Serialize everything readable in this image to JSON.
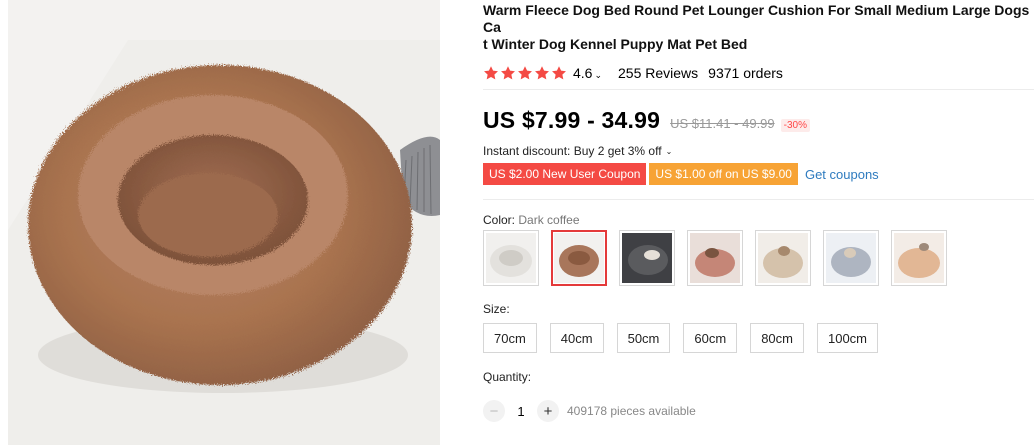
{
  "product": {
    "title": "Warm Fleece Dog Bed Round Pet Lounger Cushion For Small Medium Large Dogs Ca\nt Winter Dog Kennel Puppy Mat Pet Bed",
    "image_alt": "Round fluffy dark coffee pet bed"
  },
  "rating": {
    "value": "4.6",
    "stars": 5,
    "star_color": "#f44a44",
    "reviews": "255 Reviews",
    "orders": "9371 orders"
  },
  "pricing": {
    "price": "US $7.99 - 34.99",
    "original_price": "US $11.41 - 49.99",
    "discount": "-30%",
    "instant_discount": "Instant discount: Buy 2 get 3% off"
  },
  "coupons": {
    "new_user": "US $2.00 New User Coupon",
    "store": "US $1.00 off on US $9.00",
    "get_coupons": "Get coupons"
  },
  "color": {
    "label": "Color:",
    "selected": "Dark coffee",
    "options": [
      {
        "name": "white",
        "fill": "#e9e7e3"
      },
      {
        "name": "dark coffee",
        "fill": "#a8765b"
      },
      {
        "name": "dark grey",
        "fill": "#5a5b5e"
      },
      {
        "name": "pink",
        "fill": "#c58677"
      },
      {
        "name": "beige",
        "fill": "#d5c2ab"
      },
      {
        "name": "light grey",
        "fill": "#aeb5c1"
      },
      {
        "name": "apricot",
        "fill": "#e2b795"
      }
    ],
    "selected_index": 1,
    "accent": "#e43a3a"
  },
  "size": {
    "label": "Size:",
    "options": [
      "70cm",
      "40cm",
      "50cm",
      "60cm",
      "80cm",
      "100cm"
    ]
  },
  "quantity": {
    "label": "Quantity:",
    "minus": "−",
    "plus": "+",
    "value": "1",
    "available": "409178 pieces available"
  }
}
